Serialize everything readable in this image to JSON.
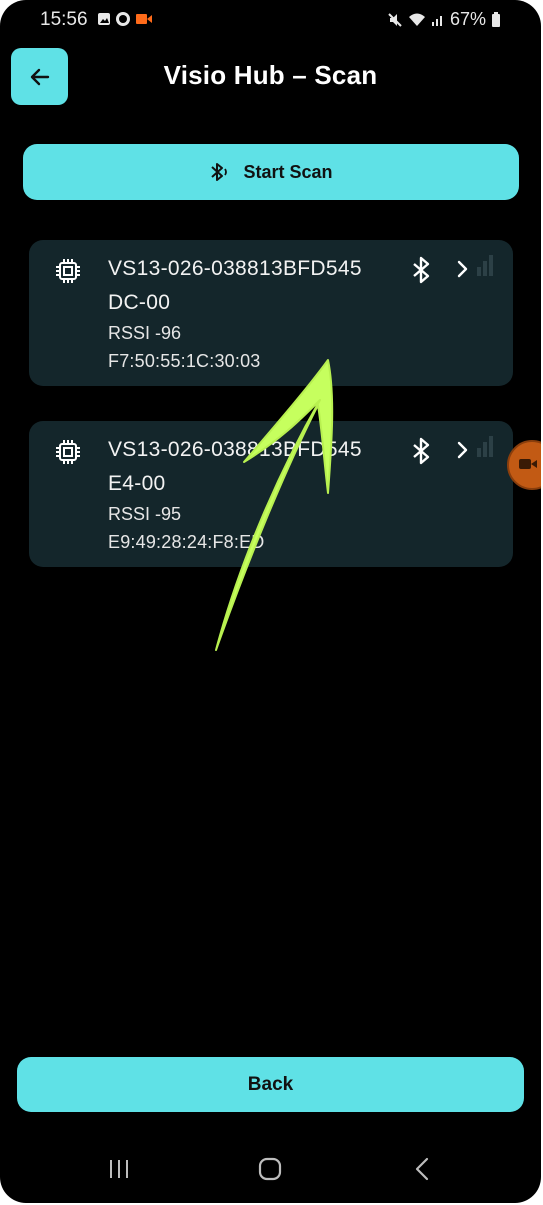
{
  "status_bar": {
    "time": "15:56",
    "battery": "67%",
    "colors": {
      "recording": "#ff6b1a"
    }
  },
  "header": {
    "title": "Visio Hub – Scan",
    "back_icon": "arrow-left-icon"
  },
  "scan_button": {
    "label": "Start Scan",
    "icon": "bluetooth-searching-icon"
  },
  "devices": [
    {
      "name": "VS13-026-038813BFD545",
      "suffix": "DC-00",
      "rssi": "RSSI -96",
      "mac": "F7:50:55:1C:30:03"
    },
    {
      "name": "VS13-026-038813BFD545",
      "suffix": "E4-00",
      "rssi": "RSSI -95",
      "mac": "E9:49:28:24:F8:ED"
    }
  ],
  "bottom_button": {
    "label": "Back"
  },
  "nav": {
    "icons": [
      "recent-apps-icon",
      "home-icon",
      "back-icon"
    ]
  },
  "colors": {
    "accent": "#5fe1e6",
    "card_bg": "#14262b",
    "background": "#000000",
    "annotation_arrow": "#c6ff5e"
  }
}
